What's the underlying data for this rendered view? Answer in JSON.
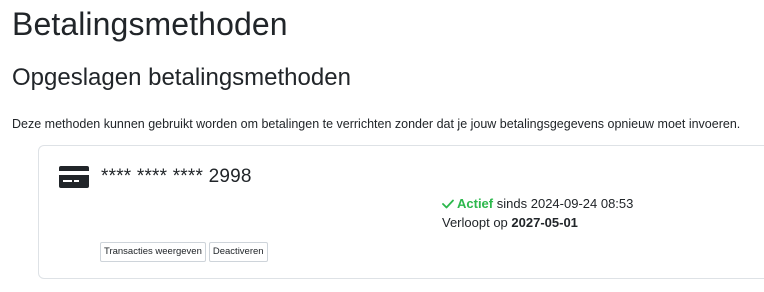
{
  "page": {
    "title": "Betalingsmethoden"
  },
  "saved_methods": {
    "title": "Opgeslagen betalingsmethoden",
    "description": "Deze methoden kunnen gebruikt worden om betalingen te verrichten zonder dat je jouw betalingsgegevens opnieuw moet invoeren.",
    "items": [
      {
        "icon": "credit-card-icon",
        "card_number": "**** **** **** 2998",
        "status_icon": "check-icon",
        "status_label": "Actief",
        "since_label": "sinds",
        "since_date": "2024-09-24 08:53",
        "expiry_label": "Verloopt op",
        "expiry_date": "2027-05-01",
        "actions": {
          "view_transactions": "Transacties weergeven",
          "deactivate": "Deactiveren"
        }
      }
    ]
  },
  "colors": {
    "text": "#212529",
    "success": "#2db84d",
    "border": "#dee2e6"
  }
}
